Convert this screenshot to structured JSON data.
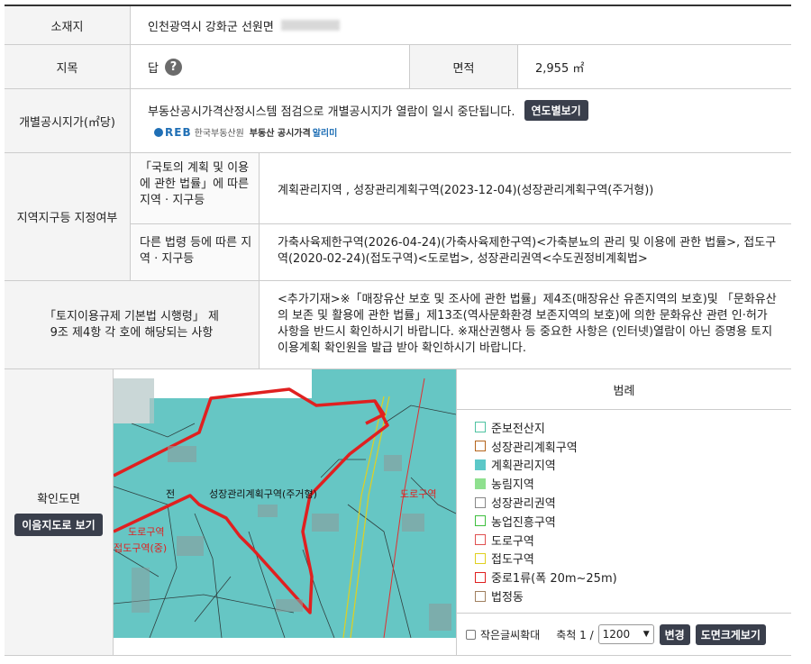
{
  "location": {
    "label": "소재지",
    "value": "인천광역시 강화군 선원면"
  },
  "land_category": {
    "label": "지목",
    "value": "답",
    "help_icon": "question-icon"
  },
  "area": {
    "label": "면적",
    "value": "2,955 ㎡"
  },
  "official_price": {
    "label": "개별공시지가(㎡당)",
    "notice": "부동산공시가격산정시스템 점검으로 개별공시지가 열람이 일시 중단됩니다.",
    "year_button": "연도별보기",
    "logo_mark": "REB",
    "logo_org": "한국부동산원",
    "logo_service": "부동산 공시가격",
    "logo_service_accent": "알리미"
  },
  "zoning": {
    "label": "지역지구등 지정여부",
    "national_law_label": "「국토의 계획 및 이용에 관한 법률」에 따른 지역 · 지구등",
    "national_law_value": "계획관리지역 , 성장관리계획구역(2023-12-04)(성장관리계획구역(주거형))",
    "other_law_label": "다른 법령 등에 따른 지역 · 지구등",
    "other_law_value": "가축사육제한구역(2026-04-24)(가축사육제한구역)<가축분뇨의 관리 및 이용에 관한 법률>, 접도구역(2020-02-24)(접도구역)<도로법>, 성장관리권역<수도권정비계획법>"
  },
  "enforcement": {
    "label": "「토지이용규제 기본법 시행령」 제9조 제4항 각 호에 해당되는 사항",
    "value": "<추가기재>※「매장유산 보호 및 조사에 관한 법률」제4조(매장유산 유존지역의 보호)및 「문화유산의 보존 및 활용에 관한 법률」제13조(역사문화환경 보존지역의 보호)에 의한 문화유산 관련 인·허가 사항을 반드시 확인하시기 바랍니다. ※재산권행사 등 중요한 사항은 (인터넷)열람이 아닌 증명용 토지이용계획 확인원을 발급 받아 확인하시기 바랍니다."
  },
  "map_section": {
    "label": "확인도면",
    "view_button": "이음지도로 보기",
    "map_labels": {
      "zone": "성장관리계획구역(주거형)",
      "road": "도로구역",
      "parcel": "전",
      "road_left": "도로구역",
      "road_left2": "접도구역(중)"
    }
  },
  "legend": {
    "title": "범례",
    "items": [
      {
        "label": "준보전산지",
        "color": "#ffffff",
        "border": "#4fc3a1"
      },
      {
        "label": "성장관리계획구역",
        "color": "#ffffff",
        "border": "#b5651d"
      },
      {
        "label": "계획관리지역",
        "color": "#5cc8c8",
        "border": "#5cc8c8"
      },
      {
        "label": "농림지역",
        "color": "#8fe08f",
        "border": "#8fe08f"
      },
      {
        "label": "성장관리권역",
        "color": "#ffffff",
        "border": "#888888"
      },
      {
        "label": "농업진흥구역",
        "color": "#ffffff",
        "border": "#3fbf3f"
      },
      {
        "label": "도로구역",
        "color": "#ffffff",
        "border": "#e05050"
      },
      {
        "label": "접도구역",
        "color": "#ffffff",
        "border": "#e0d020"
      },
      {
        "label": "중로1류(폭 20m~25m)",
        "color": "#ffffff",
        "border": "#e02020"
      },
      {
        "label": "법정동",
        "color": "#ffffff",
        "border": "#a08060"
      }
    ]
  },
  "controls": {
    "small_text_label": "작은글씨확대",
    "scale_label": "축척 1 /",
    "scale_value": "1200",
    "change_button": "변경",
    "large_view_button": "도면크게보기"
  }
}
